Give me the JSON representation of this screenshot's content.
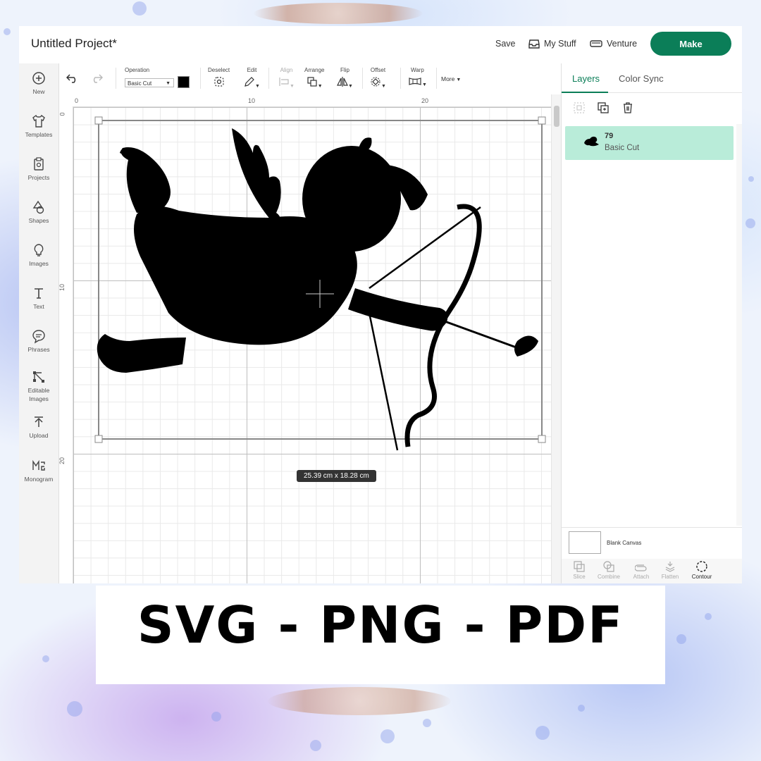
{
  "header": {
    "project_title": "Untitled Project*",
    "save_label": "Save",
    "my_stuff_label": "My Stuff",
    "machine_label": "Venture",
    "make_label": "Make"
  },
  "sidebar": {
    "items": [
      {
        "label": "New",
        "icon": "plus-circle-icon"
      },
      {
        "label": "Templates",
        "icon": "shirt-icon"
      },
      {
        "label": "Projects",
        "icon": "clipboard-icon"
      },
      {
        "label": "Shapes",
        "icon": "shapes-icon"
      },
      {
        "label": "Images",
        "icon": "lightbulb-icon"
      },
      {
        "label": "Text",
        "icon": "text-icon"
      },
      {
        "label": "Phrases",
        "icon": "speech-bubble-icon"
      },
      {
        "label": "Editable Images",
        "icon": "node-edit-icon"
      },
      {
        "label": "Upload",
        "icon": "upload-icon"
      },
      {
        "label": "Monogram",
        "icon": "monogram-icon"
      }
    ]
  },
  "toolbar": {
    "operation_label": "Operation",
    "operation_value": "Basic Cut",
    "deselect_label": "Deselect",
    "edit_label": "Edit",
    "align_label": "Align",
    "arrange_label": "Arrange",
    "flip_label": "Flip",
    "offset_label": "Offset",
    "warp_label": "Warp",
    "more_label": "More",
    "color": "#000000"
  },
  "canvas": {
    "ruler_top": [
      "0",
      "10",
      "20"
    ],
    "ruler_left": [
      "0",
      "10",
      "20"
    ],
    "dimensions": "25.39  cm x 18.28  cm",
    "image": "cupid-silhouette"
  },
  "panel": {
    "tab_layers": "Layers",
    "tab_color_sync": "Color Sync",
    "layer": {
      "name": "79",
      "operation": "Basic Cut"
    },
    "blank_canvas_label": "Blank Canvas",
    "tools": [
      "Slice",
      "Combine",
      "Attach",
      "Flatten",
      "Contour"
    ]
  },
  "banner": {
    "formats": "SVG - PNG - PDF"
  },
  "colors": {
    "accent": "#0b7e58",
    "layer_highlight": "#b9ecd9"
  }
}
